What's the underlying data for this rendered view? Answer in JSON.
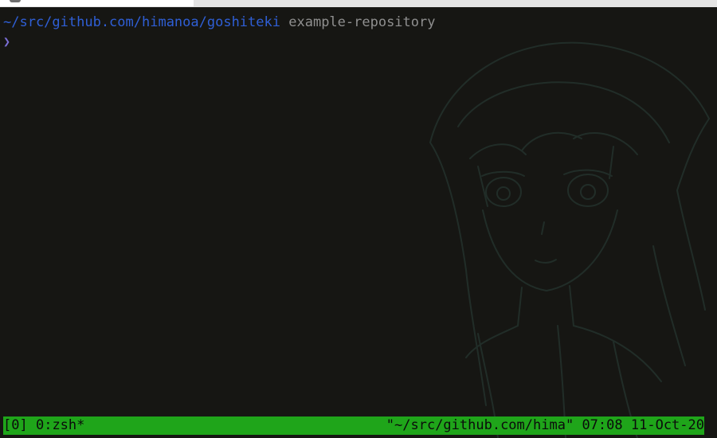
{
  "terminal": {
    "cwd_path": "~/src/github.com/himanoa/goshiteki",
    "repo_name": "example-repository",
    "prompt_symbol": "❯"
  },
  "status_bar": {
    "session": "[0]",
    "window": "0:zsh*",
    "pane_title": "\"~/src/github.com/hima\"",
    "time": "07:08",
    "date": "11-Oct-20"
  },
  "colors": {
    "background": "#161613",
    "path": "#2f5fd6",
    "repo": "#8f8f8f",
    "prompt": "#7b6fd6",
    "status_bar": "#1fa51a"
  }
}
